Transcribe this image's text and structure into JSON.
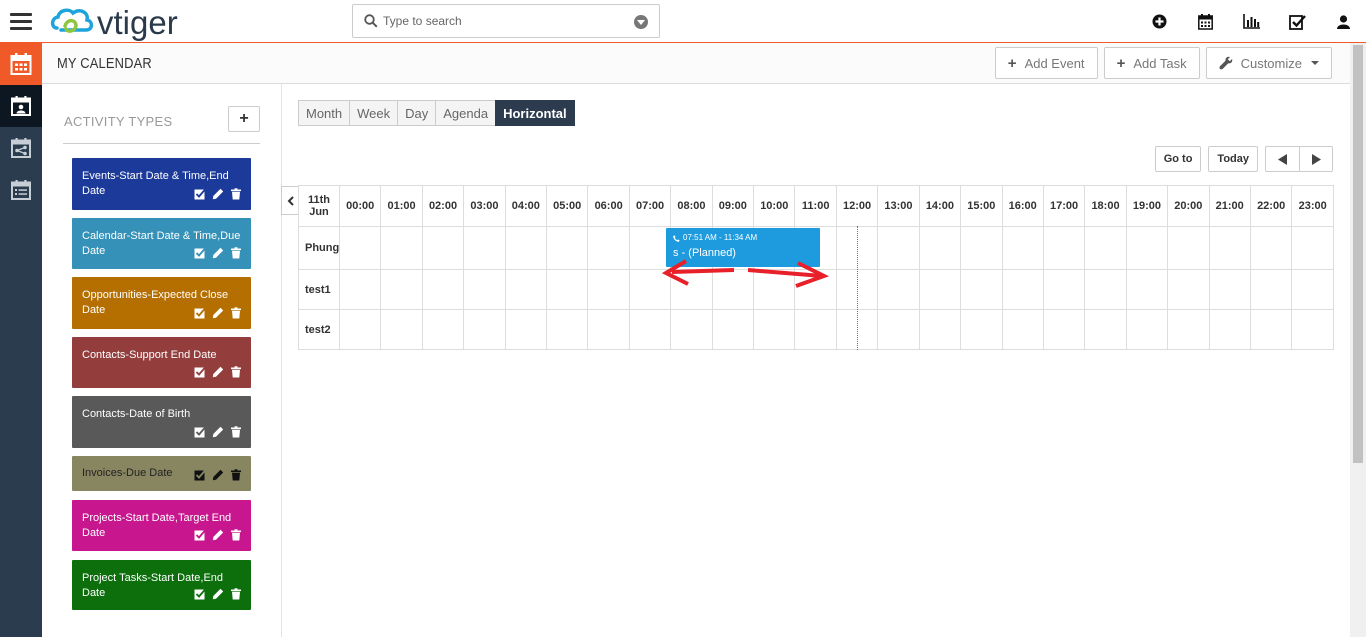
{
  "app": {
    "logo_text": "vtiger"
  },
  "search": {
    "placeholder": "Type to search"
  },
  "module": {
    "title": "MY CALENDAR"
  },
  "actions": {
    "add_event": "Add Event",
    "add_task": "Add Task",
    "customize": "Customize"
  },
  "sidebar": {
    "heading": "ACTIVITY TYPES",
    "add_label": "+",
    "items": [
      {
        "label": "Events-Start Date & Time,End Date",
        "color": "#1c3a9a"
      },
      {
        "label": "Calendar-Start Date & Time,Due Date",
        "color": "#3591b7"
      },
      {
        "label": "Opportunities-Expected Close Date",
        "color": "#b56f00"
      },
      {
        "label": "Contacts-Support End Date",
        "color": "#943d3d"
      },
      {
        "label": "Contacts-Date of Birth",
        "color": "#595959"
      },
      {
        "label": "Invoices-Due Date",
        "color": "#888561"
      },
      {
        "label": "Projects-Start Date,Target End Date",
        "color": "#c7168e"
      },
      {
        "label": "Project Tasks-Start Date,End Date",
        "color": "#0c6f0c"
      }
    ]
  },
  "views": {
    "month": "Month",
    "week": "Week",
    "day": "Day",
    "agenda": "Agenda",
    "horizontal": "Horizontal"
  },
  "nav": {
    "goto": "Go to",
    "today": "Today"
  },
  "timeline": {
    "date_line1": "11th",
    "date_line2": "Jun",
    "hours": [
      "00:00",
      "01:00",
      "02:00",
      "03:00",
      "04:00",
      "05:00",
      "06:00",
      "07:00",
      "08:00",
      "09:00",
      "10:00",
      "11:00",
      "12:00",
      "13:00",
      "14:00",
      "15:00",
      "16:00",
      "17:00",
      "18:00",
      "19:00",
      "20:00",
      "21:00",
      "22:00",
      "23:00"
    ],
    "resources": [
      "Phung",
      "test1",
      "test2"
    ]
  },
  "event": {
    "time": "07:51 AM - 11:34 AM",
    "title": "s - (Planned)",
    "color": "#1e9bde"
  }
}
